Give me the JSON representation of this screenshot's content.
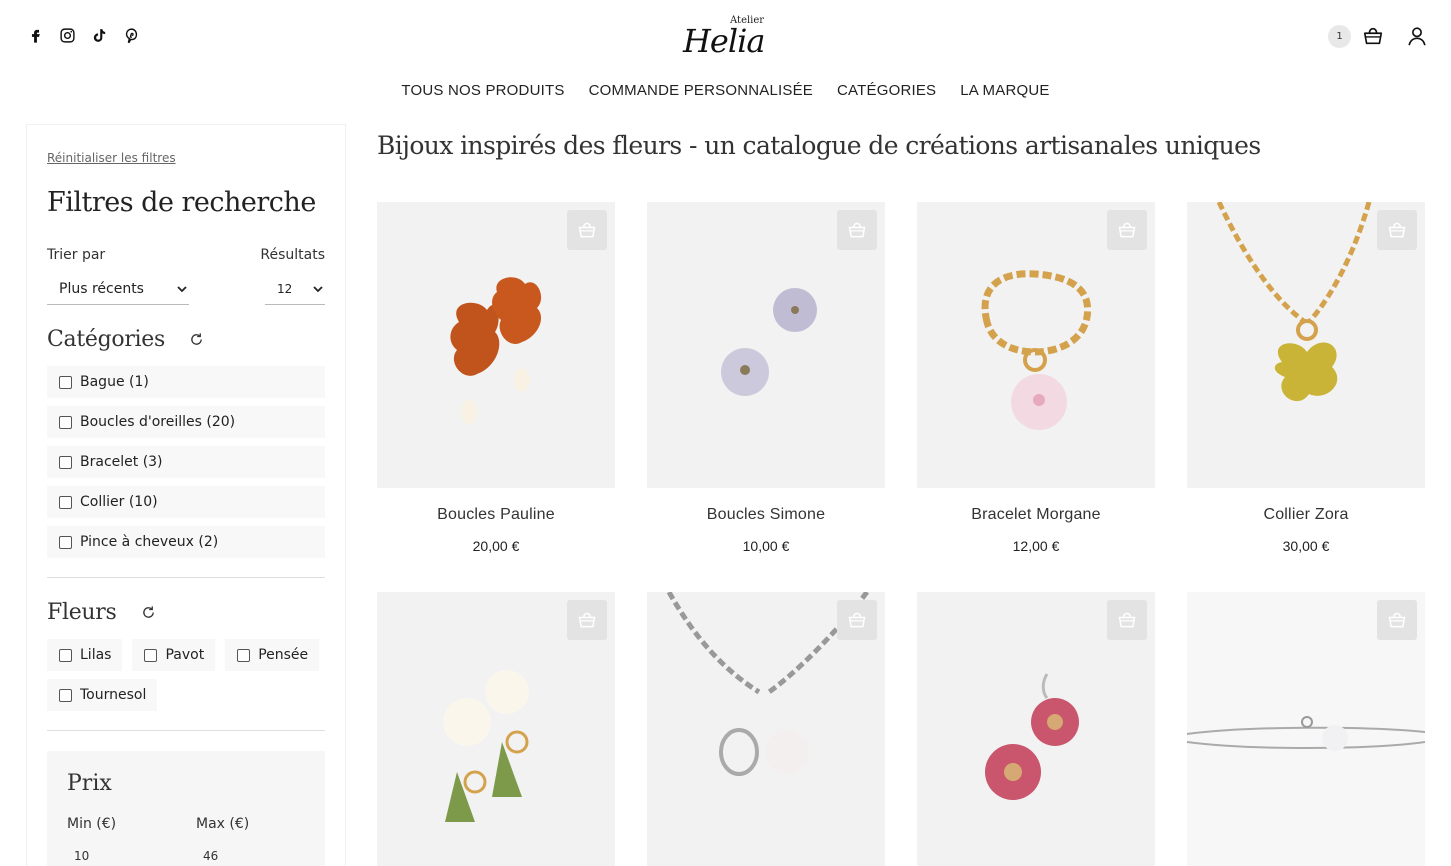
{
  "header": {
    "socials": [
      "facebook-icon",
      "instagram-icon",
      "tiktok-icon",
      "pinterest-icon"
    ],
    "logo_small": "Atelier",
    "logo_big": "Helia",
    "cart_count": "1"
  },
  "nav": {
    "items": [
      "TOUS NOS PRODUITS",
      "COMMANDE PERSONNALISÉE",
      "CATÉGORIES",
      "LA MARQUE"
    ]
  },
  "sidebar": {
    "reset_label": "Réinitialiser les filtres",
    "title": "Filtres de recherche",
    "sort_label": "Trier par",
    "sort_value": "Plus récents",
    "results_label": "Résultats",
    "results_value": "12",
    "categories_title": "Catégories",
    "categories": [
      "Bague (1)",
      "Boucles d'oreilles (20)",
      "Bracelet (3)",
      "Collier (10)",
      "Pince à cheveux (2)"
    ],
    "flowers_title": "Fleurs",
    "flowers": [
      "Lilas",
      "Pavot",
      "Pensée",
      "Tournesol"
    ],
    "price": {
      "title": "Prix",
      "min_label": "Min (€)",
      "max_label": "Max (€)",
      "min_value": "10",
      "max_value": "46"
    }
  },
  "main": {
    "title": "Bijoux inspirés des fleurs - un catalogue de créations artisanales uniques",
    "products": [
      {
        "name": "Boucles Pauline",
        "price": "20,00 €"
      },
      {
        "name": "Boucles Simone",
        "price": "10,00 €"
      },
      {
        "name": "Bracelet Morgane",
        "price": "12,00 €"
      },
      {
        "name": "Collier Zora",
        "price": "30,00 €"
      },
      {
        "name": "",
        "price": ""
      },
      {
        "name": "",
        "price": ""
      },
      {
        "name": "",
        "price": ""
      },
      {
        "name": "",
        "price": ""
      }
    ]
  },
  "colors": {
    "text": "#222222",
    "chip_bg": "#f8f8f8",
    "button_bg": "#e3e3e3"
  }
}
